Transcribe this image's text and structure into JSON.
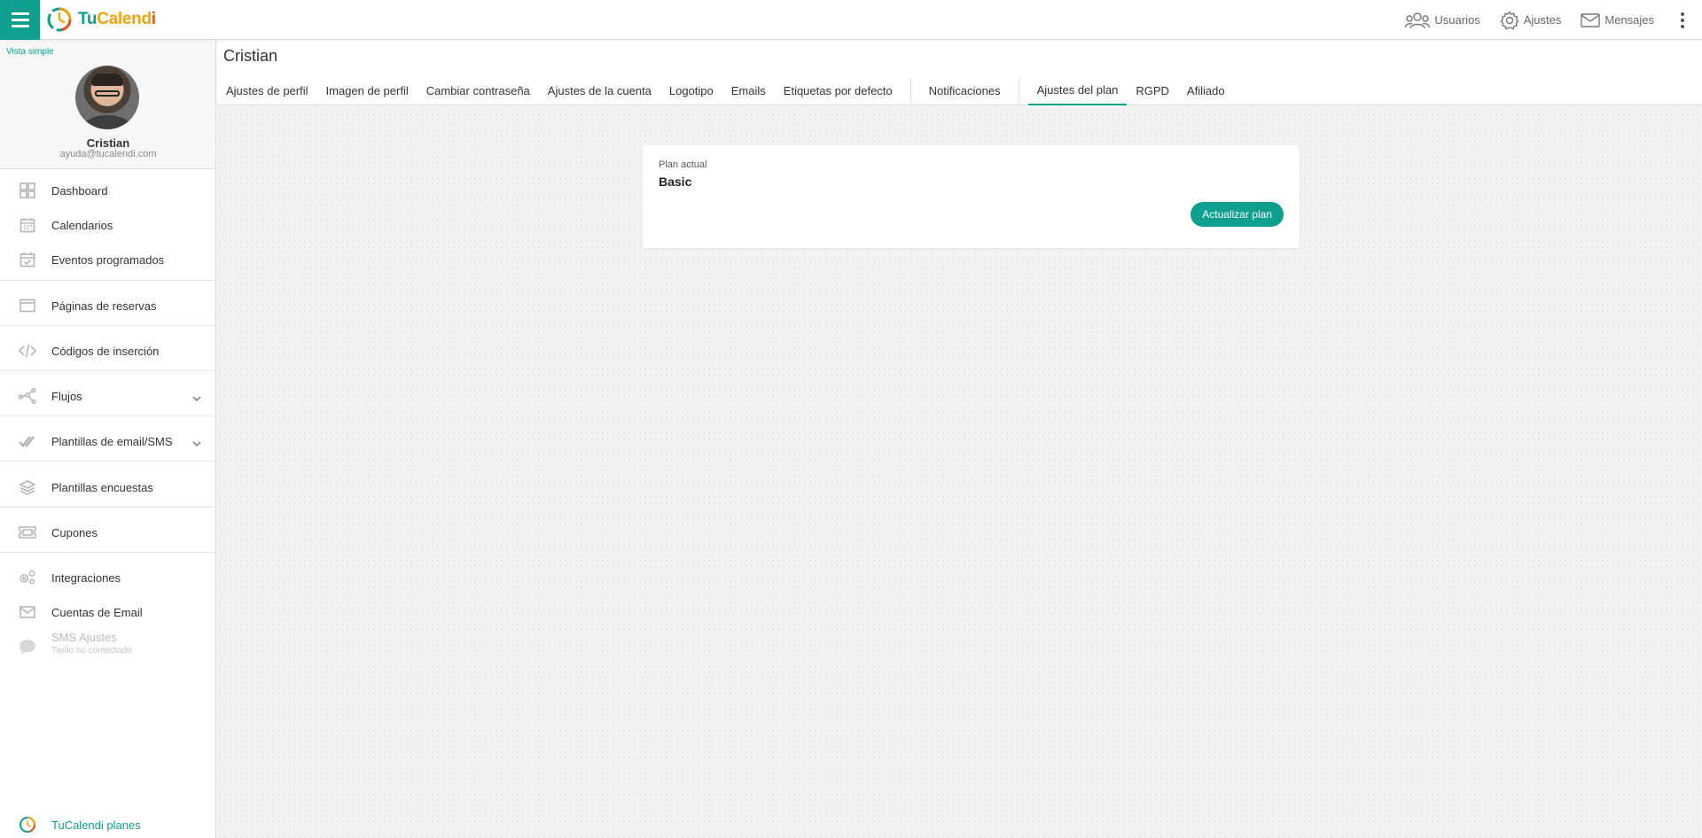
{
  "brand": {
    "tu": "Tu",
    "calend": "Calend",
    "i": "i"
  },
  "topbar": {
    "users_label": "Usuarios",
    "settings_label": "Ajustes",
    "messages_label": "Mensajes"
  },
  "sidebar": {
    "vista_simple": "Vista simple",
    "user_name": "Cristian",
    "user_email": "ayuda@tucalendi.com",
    "items": {
      "dashboard": "Dashboard",
      "calendarios": "Calendarios",
      "eventos": "Eventos programados",
      "paginas": "Páginas de reservas",
      "codigos": "Códigos de inserción",
      "flujos": "Flujos",
      "plantillas_email": "Plantillas de email/SMS",
      "plantillas_encuestas": "Plantillas encuestas",
      "cupones": "Cupones",
      "integraciones": "Integraciones",
      "cuentas_email": "Cuentas de Email",
      "sms_ajustes": "SMS Ajustes",
      "sms_status": "Twilio no contectado"
    },
    "plans_link": "TuCalendi planes"
  },
  "main": {
    "title": "Cristian",
    "tabs": [
      "Ajustes de perfil",
      "Imagen de perfil",
      "Cambiar contraseña",
      "Ajustes de la cuenta",
      "Logotipo",
      "Emails",
      "Etiquetas por defecto",
      "Notificaciones",
      "Ajustes del plan",
      "RGPD",
      "Afiliado"
    ],
    "active_tab": "Ajustes del plan"
  },
  "plan_card": {
    "label": "Plan actual",
    "value": "Basic",
    "button": "Actualizar plan"
  },
  "colors": {
    "accent": "#0e9f8e",
    "logo_orange": "#f0a30a",
    "logo_red": "#e8541c"
  }
}
